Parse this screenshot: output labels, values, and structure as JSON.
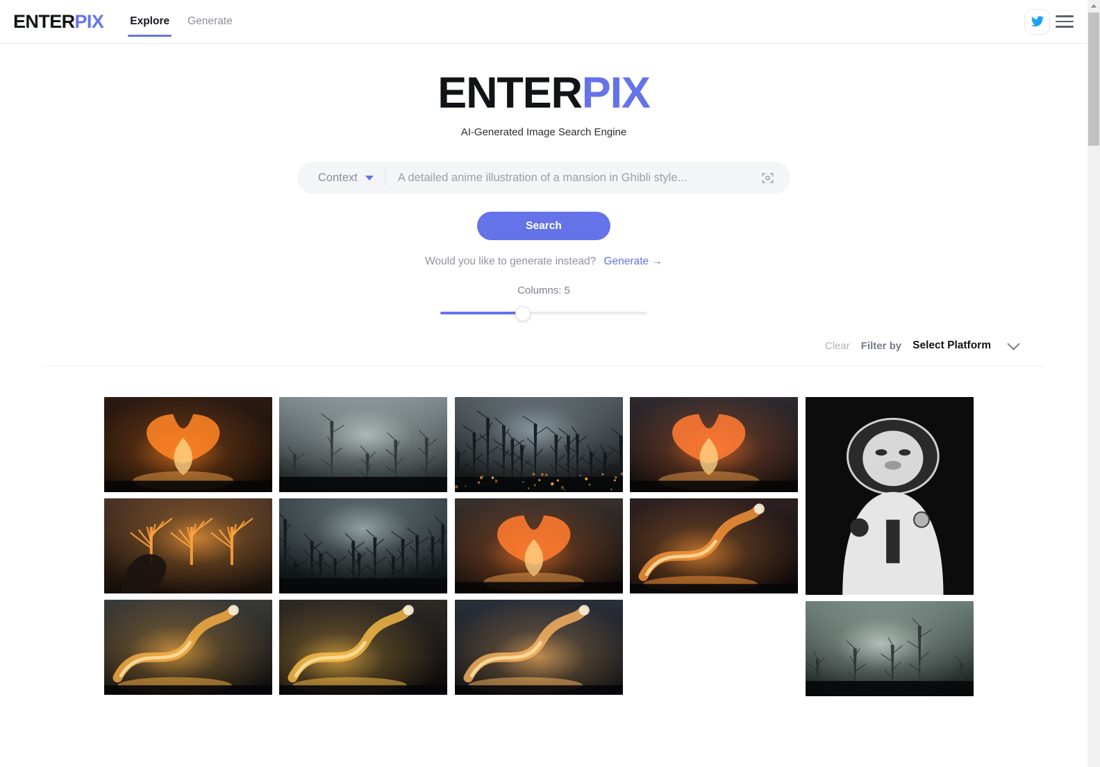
{
  "navbar": {
    "brand_part1": "ENTER",
    "brand_part2": "PIX",
    "links": [
      {
        "label": "Explore",
        "active": true
      },
      {
        "label": "Generate",
        "active": false
      }
    ],
    "twitter_icon": "twitter-icon",
    "menu_icon": "hamburger-menu-icon",
    "accent_color": "#6573e8"
  },
  "hero": {
    "logo_part1": "ENTER",
    "logo_part2": "PIX",
    "tagline": "AI-Generated Image Search Engine"
  },
  "search": {
    "context_label": "Context",
    "context_caret_icon": "caret-down-icon",
    "placeholder": "A detailed anime illustration of a mansion in Ghibli style...",
    "value": "",
    "scan_icon": "image-scan-icon",
    "button_label": "Search"
  },
  "generate_prompt": {
    "question": "Would you like to generate instead?",
    "link_label": "Generate →"
  },
  "columns_slider": {
    "label": "Columns: 5",
    "value": 5,
    "min": 1,
    "max": 10,
    "fill_percent": 40
  },
  "filter_bar": {
    "clear_label": "Clear",
    "filter_by_label": "Filter by",
    "platform_label": "Select Platform",
    "chevron_icon": "chevron-down-icon"
  },
  "gallery": {
    "tiles": [
      {
        "name": "tile-fire-phoenix-over-forest",
        "shape": "landscape",
        "theme": "fire-night"
      },
      {
        "name": "tile-burning-tree-eagle-clouds",
        "shape": "landscape",
        "theme": "fire-clouds"
      },
      {
        "name": "tile-fire-dragon-smoke-storm",
        "shape": "landscape",
        "theme": "fire-storm"
      },
      {
        "name": "tile-gnarled-tree-fog-night",
        "shape": "landscape",
        "theme": "fog-grey"
      },
      {
        "name": "tile-burnt-forest-moonlight",
        "shape": "landscape",
        "theme": "fog-dark"
      },
      {
        "name": "tile-fire-serpent-skull-smoke",
        "shape": "landscape",
        "theme": "fire-smoke"
      },
      {
        "name": "tile-charred-forest-embers",
        "shape": "landscape",
        "theme": "fog-embers"
      },
      {
        "name": "tile-flaming-phoenix-field",
        "shape": "landscape",
        "theme": "fire-phoenix"
      },
      {
        "name": "tile-fire-dragon-skull-clouds",
        "shape": "landscape",
        "theme": "fire-dragon"
      },
      {
        "name": "tile-phoenix-wings-burning-plain",
        "shape": "landscape",
        "theme": "fire-wings"
      },
      {
        "name": "tile-fire-beast-skeleton-blaze",
        "shape": "landscape",
        "theme": "fire-beast"
      },
      {
        "name": "tile-astronaut-ape-monochrome",
        "shape": "portrait",
        "theme": "mono-ape"
      },
      {
        "name": "tile-skull-tree-misty-glow",
        "shape": "landscape",
        "theme": "fog-green"
      },
      {
        "name": "tile-fire-creature-night-sky",
        "shape": "landscape",
        "theme": "fire-creature"
      },
      {
        "name": "tile-dead-forest-lanterns",
        "shape": "landscape",
        "theme": "fog-lantern"
      },
      {
        "name": "tile-soft-golden-haze",
        "shape": "half",
        "theme": "golden-haze"
      },
      {
        "name": "tile-ghostly-branch-skull",
        "shape": "half",
        "theme": "fog-pale"
      },
      {
        "name": "tile-blue-japanese-phoenix-art",
        "shape": "half",
        "theme": "blue-ukiyo"
      },
      {
        "name": "tile-woman-portrait-dark-hair",
        "shape": "half",
        "theme": "portrait-woman"
      }
    ]
  },
  "scrollbar": {
    "up_arrow_icon": "scroll-up-arrow-icon",
    "thumb_top_percent": 2,
    "thumb_height_percent": 19
  }
}
